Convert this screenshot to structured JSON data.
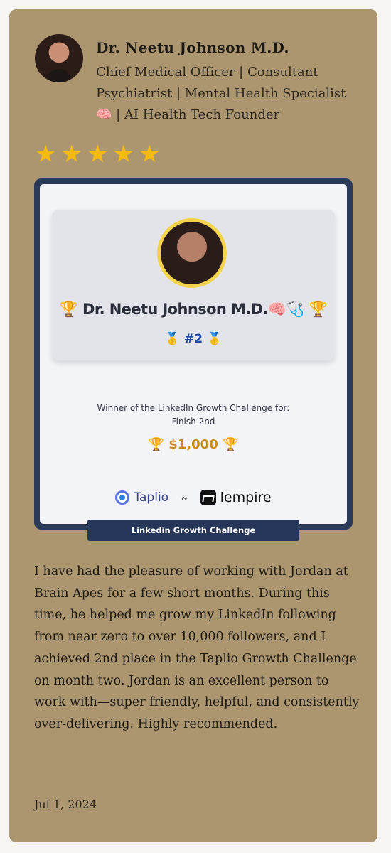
{
  "reviewer": {
    "name": "Dr. Neetu Johnson M.D.",
    "headline": "Chief Medical Officer | Consultant Psychiatrist | Mental Health Specialist 🧠 | AI Health Tech Founder"
  },
  "rating": {
    "stars": 5,
    "max": 5,
    "star_glyph": "★",
    "color": "#f5b914"
  },
  "badge": {
    "name": "🏆 Dr. Neetu Johnson M.D.🧠🩺 🏆",
    "rank": "🥇 #2 🥇",
    "winner_line1": "Winner of the LinkedIn Growth Challenge for:",
    "winner_line2": "Finish 2nd",
    "prize": "🏆 $1,000 🏆",
    "logo_taplio": "Taplio",
    "logo_amp": "&",
    "logo_lempire": "lempire",
    "ribbon": "Linkedin Growth Challenge"
  },
  "testimonial": "I have had the pleasure of working with Jordan at Brain Apes for a few short months. During this time, he helped me grow my LinkedIn following from near zero to over 10,000 followers, and I achieved 2nd place in the Taplio Growth Challenge on month two. Jordan is an excellent person to work with—super friendly, helpful, and consistently over-delivering. Highly recommended.",
  "date": "Jul 1, 2024",
  "colors": {
    "card": "#ab9670",
    "badge_frame": "#2b3a58",
    "prize": "#c98d1c"
  }
}
